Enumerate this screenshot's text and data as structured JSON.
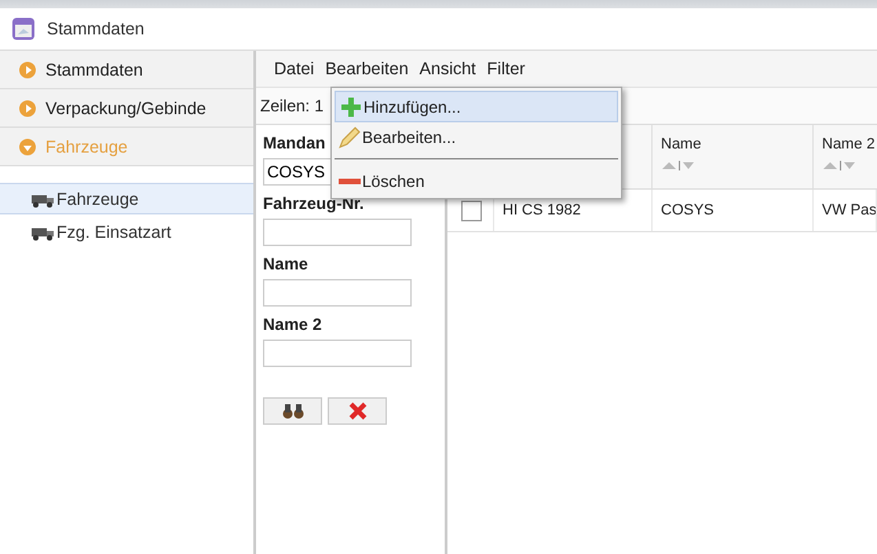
{
  "window": {
    "title": "Stammdaten"
  },
  "sidebar": {
    "sections": [
      {
        "label": "Stammdaten",
        "expanded": false
      },
      {
        "label": "Verpackung/Gebinde",
        "expanded": false
      },
      {
        "label": "Fahrzeuge",
        "expanded": true
      }
    ],
    "items": [
      {
        "label": "Fahrzeuge",
        "selected": true
      },
      {
        "label": "Fzg. Einsatzart",
        "selected": false
      }
    ]
  },
  "menubar": [
    "Datei",
    "Bearbeiten",
    "Ansicht",
    "Filter"
  ],
  "menu": {
    "items": [
      {
        "kind": "add",
        "label": "Hinzufügen...",
        "highlighted": true
      },
      {
        "kind": "edit",
        "label": "Bearbeiten...",
        "highlighted": false
      },
      {
        "kind": "separator"
      },
      {
        "kind": "delete",
        "label": "Löschen",
        "highlighted": false
      }
    ]
  },
  "toolbar": {
    "rows": "Zeilen: 1"
  },
  "filter": {
    "fields": [
      {
        "label": "Mandan",
        "value": "COSYS"
      },
      {
        "label": "Fahrzeug-Nr."
      },
      {
        "label": "Name"
      },
      {
        "label": "Name 2"
      }
    ]
  },
  "table": {
    "columns": [
      "",
      "",
      "Name",
      "Name 2"
    ],
    "rows": [
      {
        "checked": false,
        "cells": [
          "",
          "HI CS 1982",
          "COSYS",
          "VW Pas"
        ]
      }
    ]
  }
}
